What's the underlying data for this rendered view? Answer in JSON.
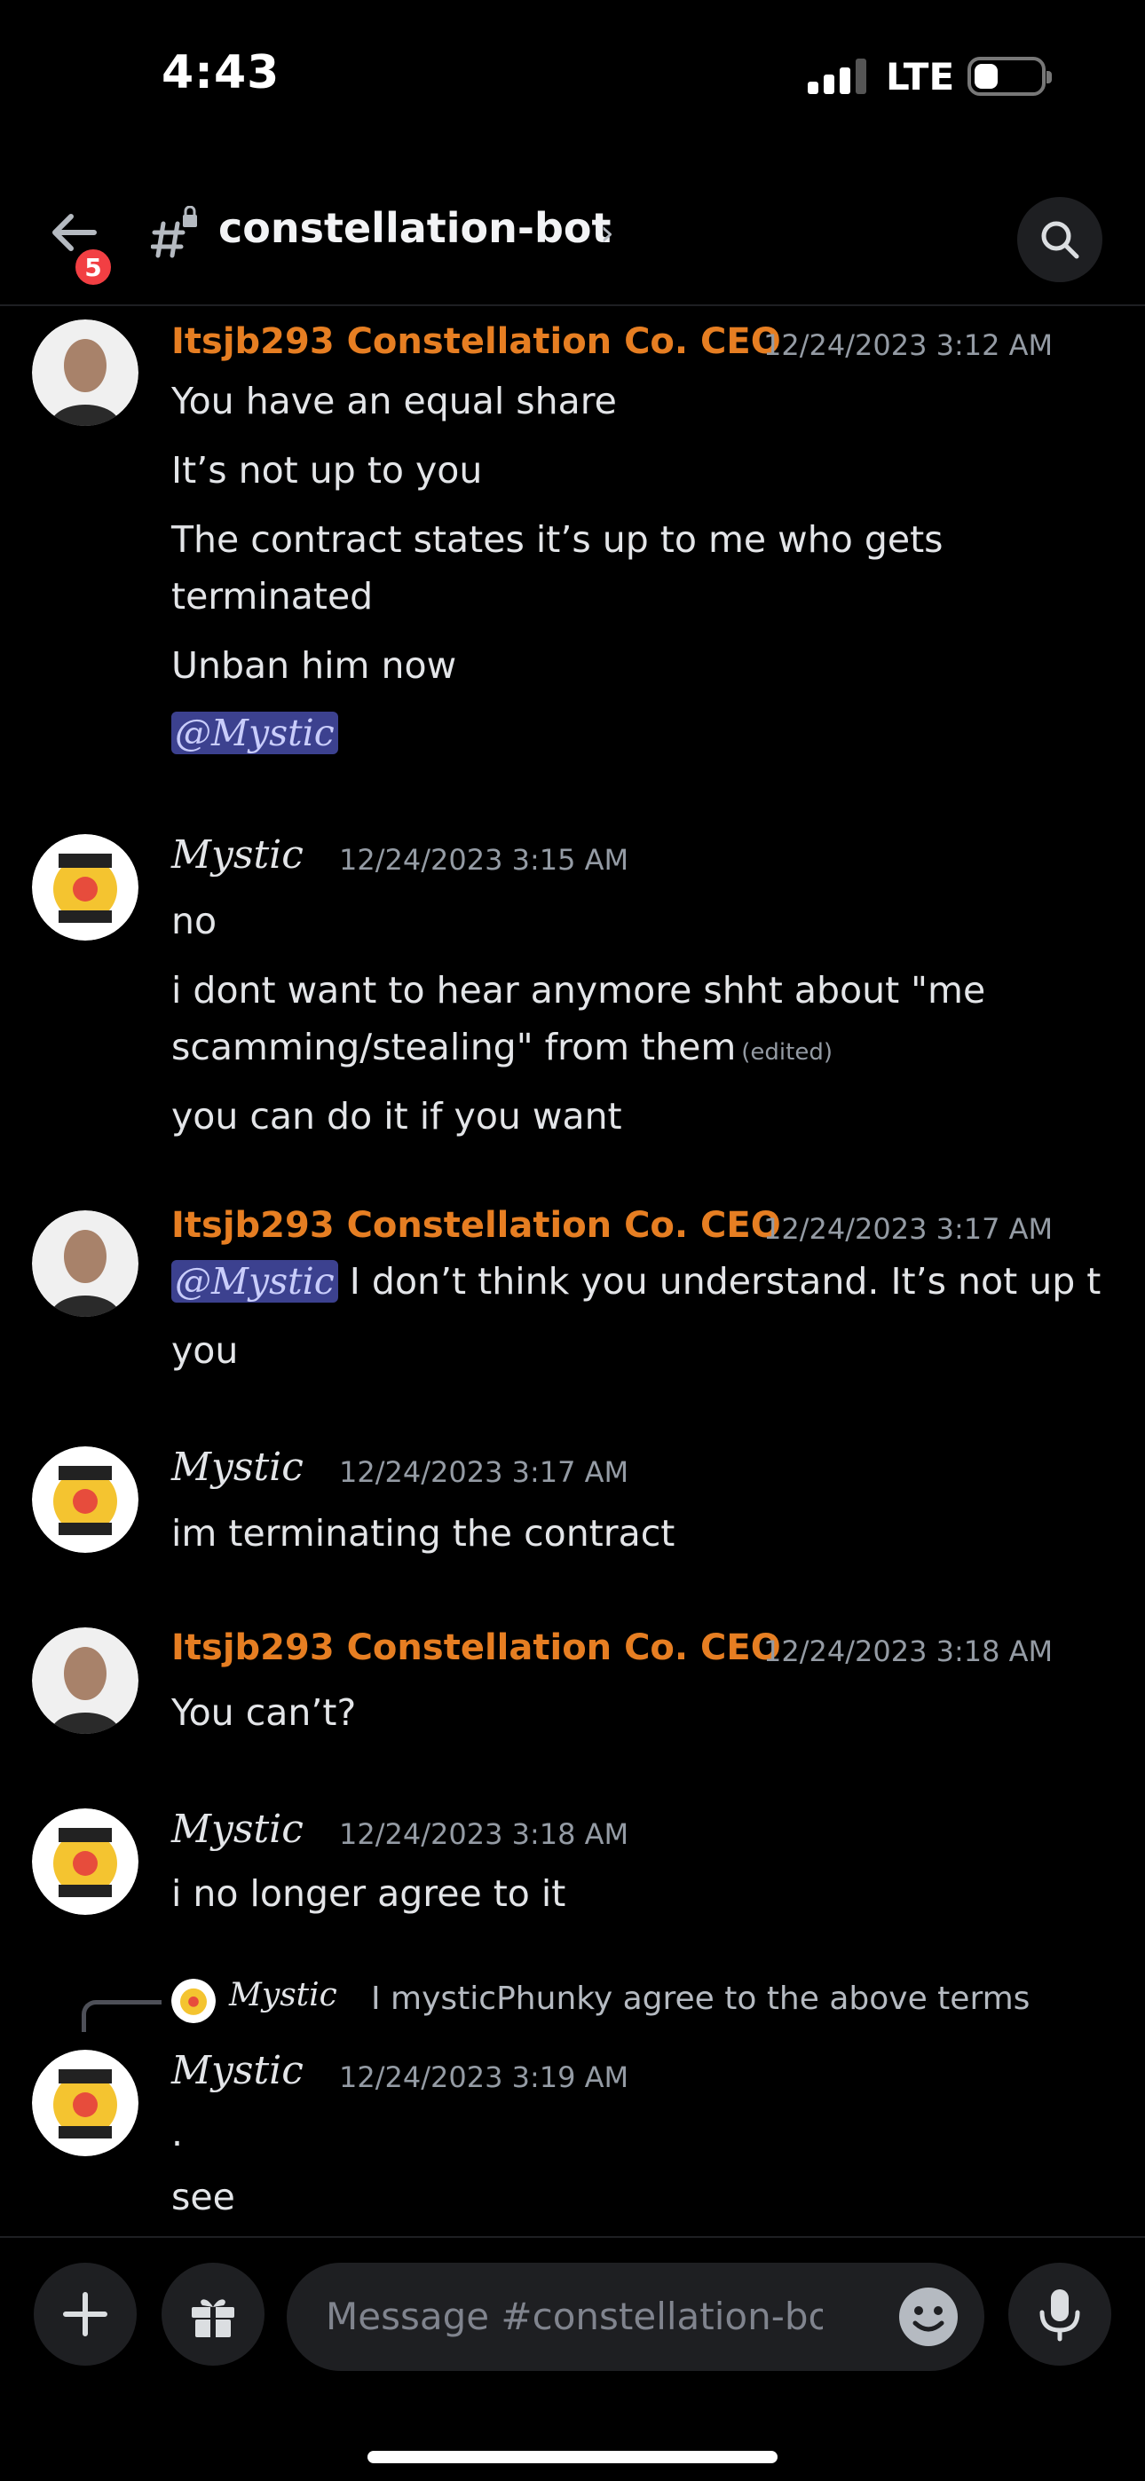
{
  "status_bar": {
    "time": "4:43",
    "network": "LTE"
  },
  "header": {
    "badge_count": "5",
    "channel_name": "constellation-bot",
    "chevron": "›"
  },
  "messages": [
    {
      "author": "Itsjb293 Constellation Co. CEO",
      "timestamp": "12/24/2023 3:12 AM",
      "lines": [
        "You have an equal share",
        "It’s not up to you",
        "The contract states it’s up to me who gets",
        "terminated",
        "Unban him now"
      ],
      "mention": "@Mystic"
    },
    {
      "author": "Mystic",
      "timestamp": "12/24/2023 3:15 AM",
      "lines": [
        "no",
        "i dont want to hear anymore shht about \"me",
        "scamming/stealing\" from them",
        "you can do it if you want"
      ],
      "edited": "(edited)"
    },
    {
      "author": "Itsjb293 Constellation Co. CEO",
      "timestamp": "12/24/2023 3:17 AM",
      "mention": "@Mystic",
      "lines": [
        "I don’t think you understand. It’s not up t",
        "you"
      ]
    },
    {
      "author": "Mystic",
      "timestamp": "12/24/2023 3:17 AM",
      "lines": [
        "im terminating the contract"
      ]
    },
    {
      "author": "Itsjb293 Constellation Co. CEO",
      "timestamp": "12/24/2023 3:18 AM",
      "lines": [
        "You can’t?"
      ]
    },
    {
      "author": "Mystic",
      "timestamp": "12/24/2023 3:18 AM",
      "lines": [
        "i no longer agree to it"
      ]
    },
    {
      "reply": {
        "author": "Mystic",
        "text": "I mysticPhunky agree to the above terms"
      },
      "author": "Mystic",
      "timestamp": "12/24/2023 3:19 AM",
      "lines": [
        ".",
        "see"
      ]
    }
  ],
  "composer": {
    "placeholder": "Message #constellation-bot"
  },
  "colors": {
    "ceo_name": "#e67e22",
    "mention_bg": "#3c418f",
    "badge": "#f23f43",
    "background": "#000000"
  },
  "icons": [
    "back-arrow-icon",
    "hash-lock-icon",
    "search-icon",
    "plus-icon",
    "gift-icon",
    "emoji-icon",
    "microphone-icon"
  ]
}
